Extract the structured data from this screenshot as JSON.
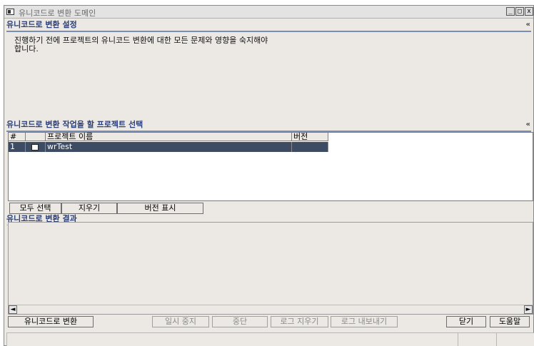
{
  "window": {
    "title": "유니코드로 변환 도메인",
    "controls": [
      "_",
      "□",
      "x"
    ]
  },
  "settings": {
    "header": "유니코드로 변환 설정",
    "collapse_icon": "«",
    "desc_line1": "진행하기 전에 프로젝트의 유니코드 변환에 대한 모든 문제와 영향을 숙지해야",
    "desc_line2": "합니다."
  },
  "projects": {
    "header": "유니코드로 변환 작업을 할 프로젝트 선택",
    "collapse_icon": "«",
    "columns": [
      "#",
      "",
      "프로젝트 이름",
      "버전"
    ],
    "rows": [
      {
        "num": "1",
        "checked": false,
        "name": "wrTest",
        "version": ""
      }
    ],
    "buttons": {
      "select_all": "모두 선택",
      "clear": "지우기",
      "show_version": "버전 표시"
    }
  },
  "results": {
    "header": "유니코드로 변환 결과"
  },
  "footer": {
    "convert": "유니코드로 변환",
    "pause": "일시 중지",
    "stop": "중단",
    "clear_log": "로그 지우기",
    "export_log": "로그 내보내기",
    "close": "닫기",
    "help": "도움말"
  },
  "colors": {
    "header_text": "#2a3f7a",
    "selected_row": "#3e4c63",
    "window_bg": "#ece9e4"
  }
}
